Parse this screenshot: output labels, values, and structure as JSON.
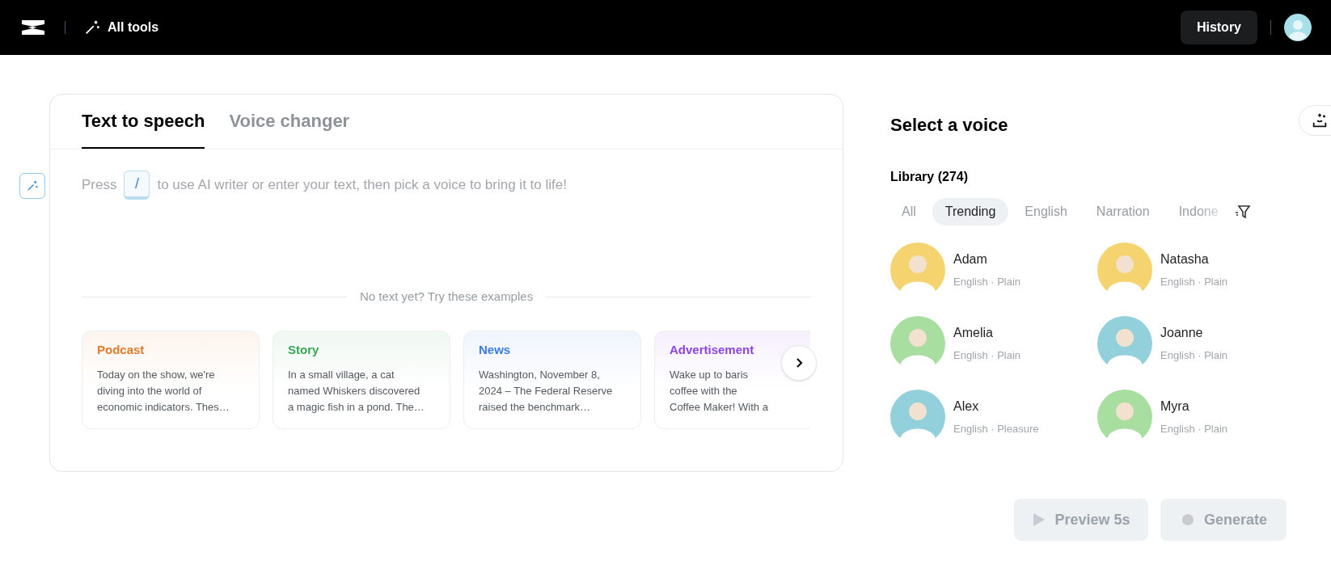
{
  "top_bar": {
    "all_tools": "All tools",
    "history": "History"
  },
  "editor": {
    "tabs": [
      {
        "label": "Text to speech",
        "selected": true
      },
      {
        "label": "Voice changer",
        "selected": false
      }
    ],
    "hint_before": "Press",
    "hint_key": "/",
    "hint_after": "to use AI writer or enter your text, then pick a voice to bring it to life!",
    "examples_divider": "No text yet? Try these examples",
    "examples": [
      {
        "title": "Podcast",
        "color": "#e07b2a",
        "lines": [
          "Today on the show, we're",
          "diving into the world of",
          "economic indicators. Thes…"
        ]
      },
      {
        "title": "Story",
        "color": "#3aa657",
        "lines": [
          "In a small village, a cat",
          "named Whiskers discovered",
          "a magic fish in a pond. The…"
        ]
      },
      {
        "title": "News",
        "color": "#3b7be0",
        "lines": [
          "Washington, November 8,",
          "2024 – The Federal Reserve",
          "raised the benchmark…"
        ]
      },
      {
        "title": "Advertisement",
        "color": "#8b44e8",
        "lines": [
          "Wake up to baris",
          "coffee with the",
          "Coffee Maker! With a"
        ]
      }
    ]
  },
  "voice_panel": {
    "title": "Select a voice",
    "library": "Library (274)",
    "filters": [
      {
        "label": "All",
        "selected": false
      },
      {
        "label": "Trending",
        "selected": true
      },
      {
        "label": "English",
        "selected": false
      },
      {
        "label": "Narration",
        "selected": false
      },
      {
        "label": "Indone",
        "selected": false
      }
    ],
    "voices": [
      {
        "name": "Adam",
        "desc": "English · Plain",
        "color": "#f5d36e"
      },
      {
        "name": "Natasha",
        "desc": "English · Plain",
        "color": "#f5d36e"
      },
      {
        "name": "Amelia",
        "desc": "English · Plain",
        "color": "#a8dea0"
      },
      {
        "name": "Joanne",
        "desc": "English · Plain",
        "color": "#92d0dc"
      },
      {
        "name": "Alex",
        "desc": "English · Pleasure",
        "color": "#92d0dc"
      },
      {
        "name": "Myra",
        "desc": "English · Plain",
        "color": "#a8dea0"
      }
    ]
  },
  "actions": [
    {
      "kind": "preview",
      "label": "Preview 5s",
      "disabled": true
    },
    {
      "kind": "generate",
      "label": "Generate",
      "disabled": true
    }
  ]
}
